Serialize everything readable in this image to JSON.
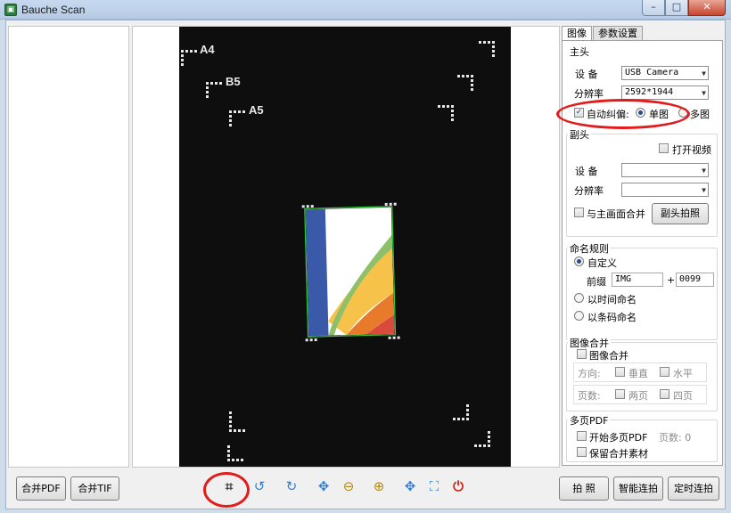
{
  "window": {
    "title": "Bauche Scan",
    "min": "–",
    "max": "□",
    "close": "✕"
  },
  "preview": {
    "sizes": [
      "A4",
      "B5",
      "A5"
    ]
  },
  "tabs": [
    {
      "label": "图像"
    },
    {
      "label": "参数设置"
    }
  ],
  "main_head": {
    "title": "主头",
    "device_label": "设 备",
    "device_value": "USB Camera",
    "resolution_label": "分辨率",
    "resolution_value": "2592*1944",
    "auto_deskew_label": "自动纠偏:",
    "auto_deskew_checked": true,
    "single_label": "单图",
    "multi_label": "多图"
  },
  "sub_head": {
    "title": "副头",
    "open_video_label": "打开视频",
    "device_label": "设 备",
    "device_value": "",
    "resolution_label": "分辨率",
    "resolution_value": "",
    "merge_label": "与主画面合并",
    "sub_capture_button": "副头拍照"
  },
  "naming": {
    "title": "命名规则",
    "custom_label": "自定义",
    "prefix_label": "前缀",
    "prefix_value": "IMG",
    "plus": "+",
    "number_value": "0099",
    "time_label": "以时间命名",
    "barcode_label": "以条码命名"
  },
  "image_merge": {
    "title": "图像合并",
    "merge_label": "图像合并",
    "direction_label": "方向:",
    "vertical_label": "垂直",
    "horizontal_label": "水平",
    "pages_label": "页数:",
    "two_pages_label": "两页",
    "four_pages_label": "四页"
  },
  "multi_pdf": {
    "title": "多页PDF",
    "start_label": "开始多页PDF",
    "pages_label": "页数: 0",
    "keep_label": "保留合并素材"
  },
  "bottom_left": {
    "merge_pdf": "合并PDF",
    "merge_tif": "合并TIF"
  },
  "bottom_right": {
    "capture": "拍 照",
    "smart_capture": "智能连拍",
    "timed_capture": "定时连拍"
  },
  "toolbar_icons": [
    "crop-icon",
    "rotate-left-icon",
    "rotate-right-icon",
    "fit-icon",
    "zoom-out-icon",
    "zoom-in-icon",
    "move-icon",
    "fullscreen-icon",
    "power-icon"
  ],
  "colors": {
    "highlight": "#e21b1b",
    "power": "#c8261b",
    "tool_blue": "#2f7fd6"
  }
}
